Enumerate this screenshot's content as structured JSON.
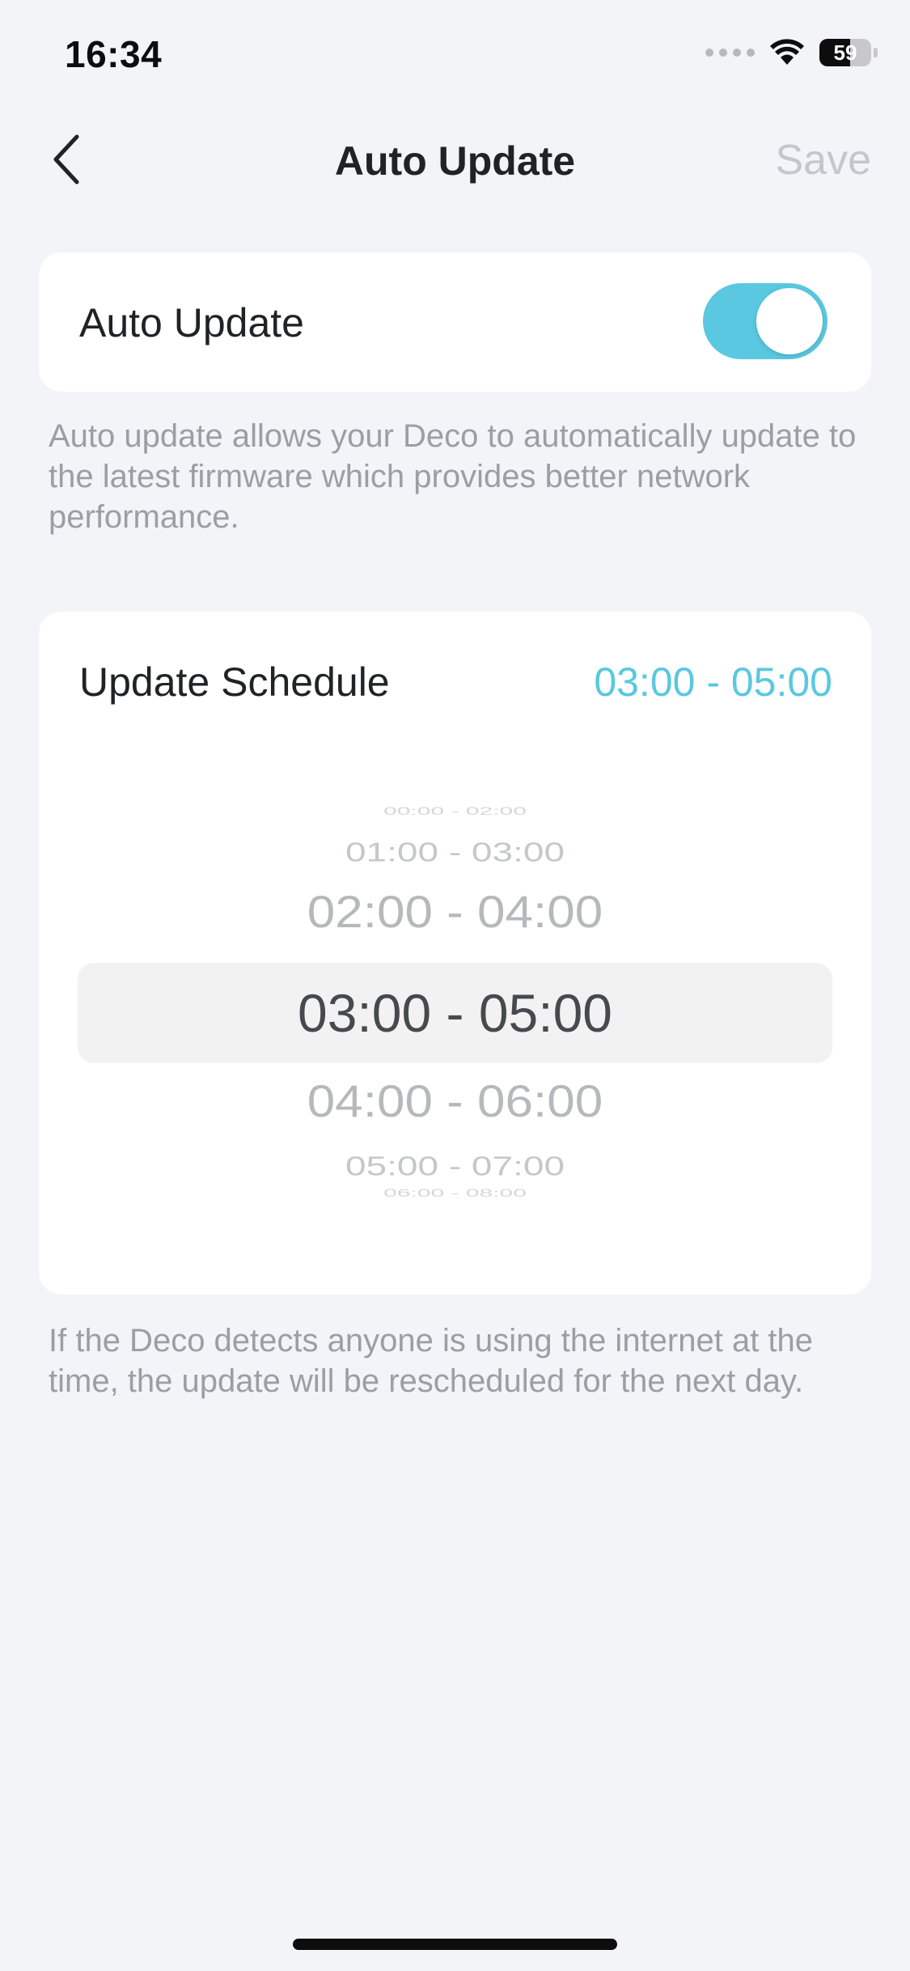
{
  "status_bar": {
    "time": "16:34",
    "battery_level": "59",
    "battery_fraction": 0.59,
    "icons": [
      "cellular-signal-icon",
      "wifi-icon",
      "battery-icon"
    ]
  },
  "nav": {
    "back_icon": "chevron-left-icon",
    "title": "Auto Update",
    "save_label": "Save"
  },
  "auto_update": {
    "label": "Auto Update",
    "enabled": true,
    "description": "Auto update allows your Deco to automatically update to the latest firmware which provides better network performance."
  },
  "schedule": {
    "label": "Update Schedule",
    "selected_value": "03:00 - 05:00",
    "picker_options": [
      "00:00 - 02:00",
      "01:00 - 03:00",
      "02:00 - 04:00",
      "03:00 - 05:00",
      "04:00 - 06:00",
      "05:00 - 07:00",
      "06:00 - 08:00"
    ],
    "description": "If the Deco detects anyone is using the internet at the time, the update will be rescheduled for the next day."
  },
  "colors": {
    "accent": "#5ac8e0",
    "background": "#f3f4f8",
    "card": "#ffffff",
    "muted_text": "#9a9ea5",
    "disabled_text": "#c3c6cb"
  }
}
